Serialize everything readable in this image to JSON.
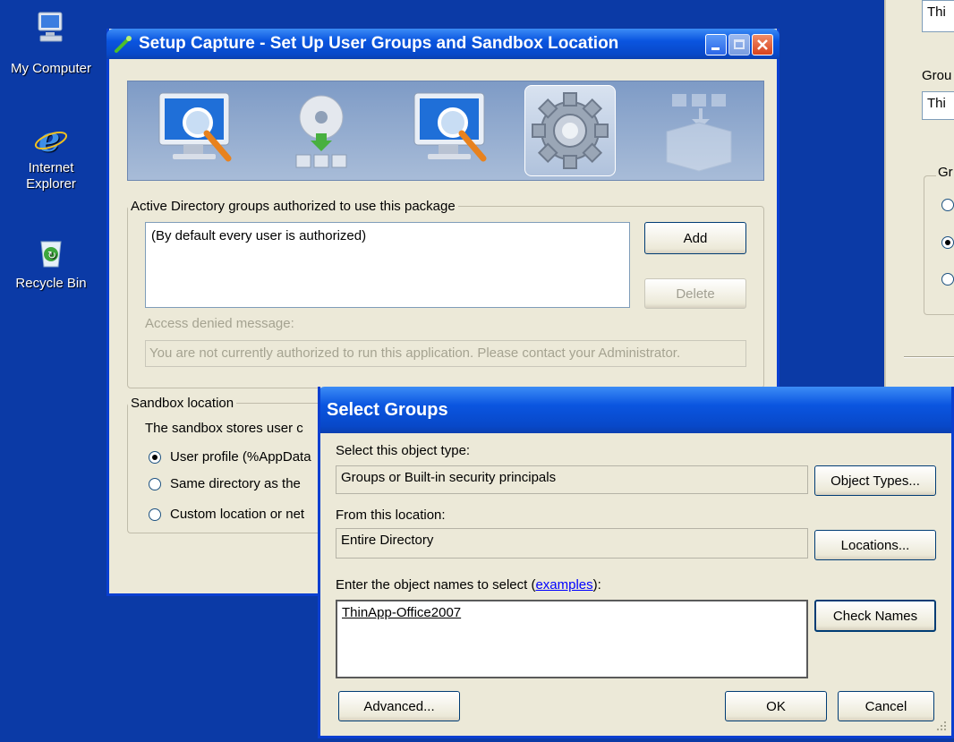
{
  "desktop": {
    "icons": [
      {
        "label": "My Computer",
        "icon": "my-computer-icon"
      },
      {
        "label": "Internet Explorer",
        "icon": "internet-explorer-icon"
      },
      {
        "label": "Recycle Bin",
        "icon": "recycle-bin-icon"
      }
    ]
  },
  "setup_window": {
    "title": "Setup Capture - Set Up User Groups and Sandbox Location",
    "steps": [
      "monitor-magnifier-icon",
      "cd-install-icon",
      "monitor-magnifier-icon",
      "gear-icon",
      "package-box-icon"
    ],
    "groups_legend": "Active Directory groups authorized to use this package",
    "groups_list_item": "(By default every user is authorized)",
    "add_button": "Add",
    "delete_button": "Delete",
    "access_denied_label": "Access denied message:",
    "access_denied_value": "You are not currently authorized to run this application. Please contact your Administrator.",
    "sandbox_legend": "Sandbox location",
    "sandbox_desc": "The sandbox stores user c",
    "radio_user_profile": "User profile (%AppData",
    "radio_same_dir": "Same directory as the",
    "radio_custom": "Custom location or net"
  },
  "back_window": {
    "field1_value": "Thi",
    "group_label": "Grou",
    "field2_value": "Thi",
    "groupbox_legend": "Gr"
  },
  "select_groups": {
    "title": "Select Groups",
    "object_type_label": "Select this object type:",
    "object_type_value": "Groups or Built-in security principals",
    "object_types_button": "Object Types...",
    "location_label": "From this location:",
    "location_value": "Entire Directory",
    "locations_button": "Locations...",
    "names_label_prefix": "Enter the object names to select (",
    "names_label_link": "examples",
    "names_label_suffix": "):",
    "names_value": "ThinApp-Office2007",
    "check_names_button": "Check Names",
    "advanced_button": "Advanced...",
    "ok_button": "OK",
    "cancel_button": "Cancel"
  }
}
